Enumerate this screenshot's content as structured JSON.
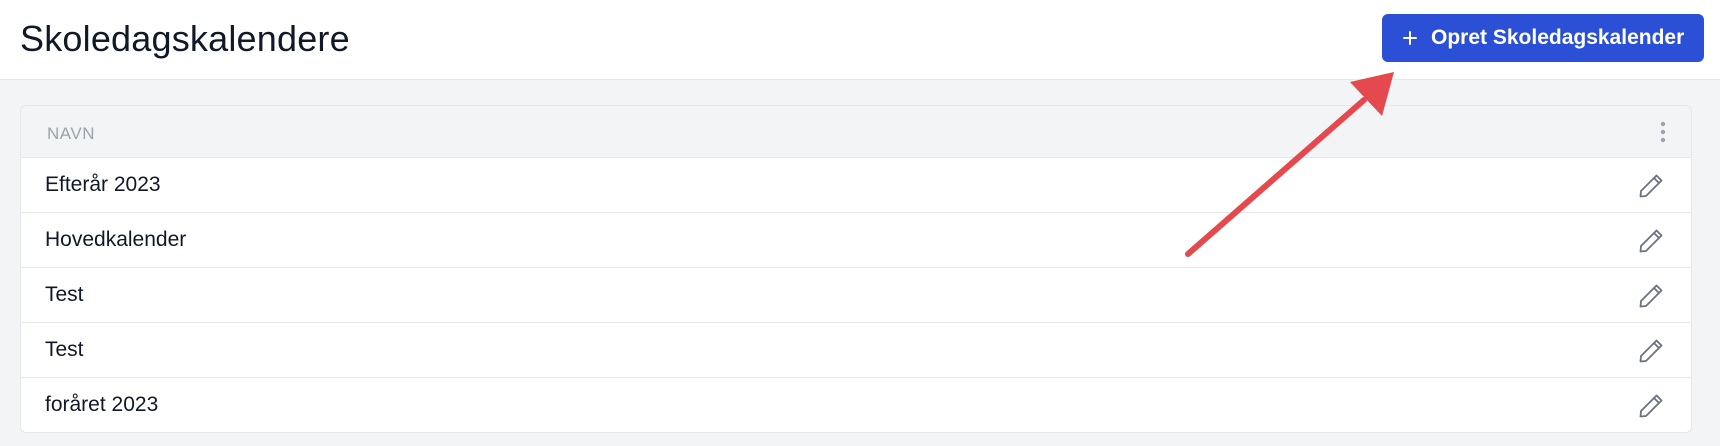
{
  "header": {
    "title": "Skoledagskalendere",
    "create_button_label": "Opret Skoledagskalender",
    "create_button_icon": "plus-icon"
  },
  "table": {
    "column_header": "NAVN",
    "menu_icon": "kebab-icon",
    "row_action_icon": "edit-icon",
    "rows": [
      {
        "name": "Efterår 2023"
      },
      {
        "name": "Hovedkalender"
      },
      {
        "name": "Test"
      },
      {
        "name": "Test"
      },
      {
        "name": "foråret 2023"
      }
    ]
  },
  "colors": {
    "primary": "#2b50d6",
    "annotation_arrow": "#e5484d",
    "header_bg": "#ffffff",
    "page_bg": "#f3f4f6",
    "muted_text": "#9ca3af",
    "icon": "#6b7280"
  }
}
